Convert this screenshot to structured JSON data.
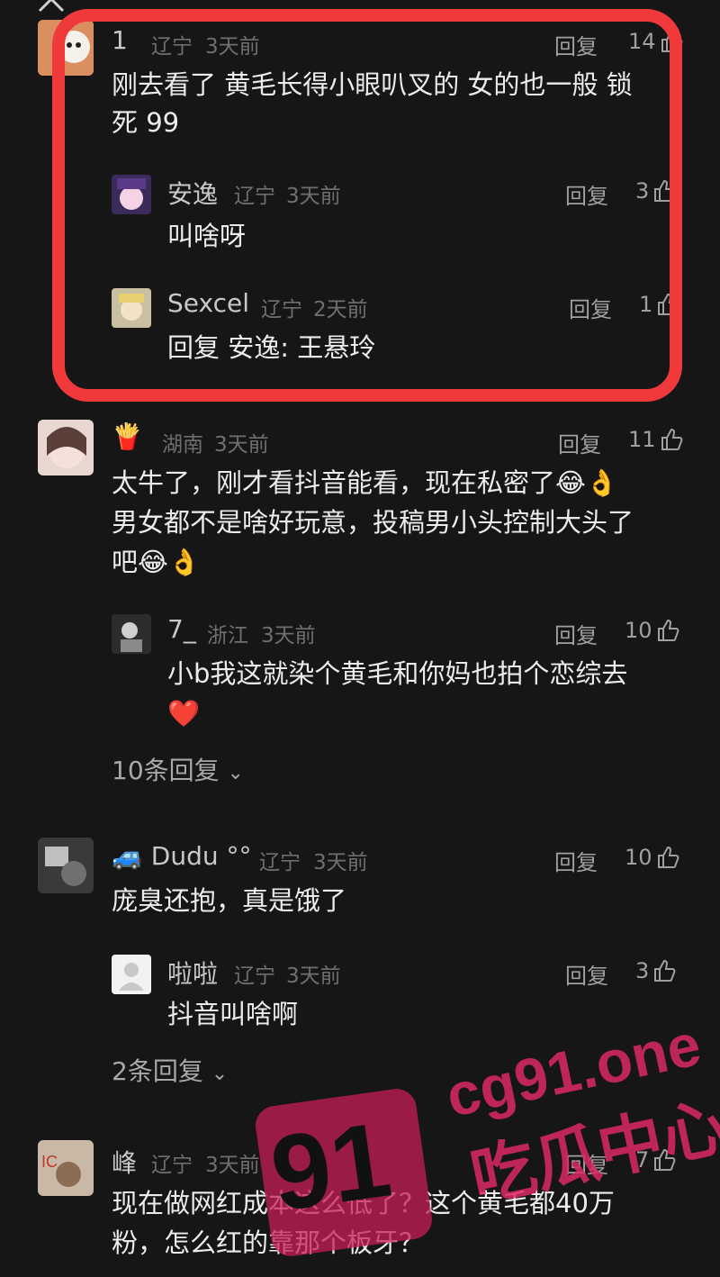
{
  "top": {
    "close_icon": "close-icon"
  },
  "comments": [
    {
      "user": "1",
      "location": "辽宁",
      "time": "3天前",
      "reply_label": "回复",
      "likes": "14",
      "text_lines": [
        "刚去看了 黄毛长得小眼叭叉的 女的也一般 锁",
        "死 99"
      ],
      "replies": [
        {
          "user": "安逸",
          "location": "辽宁",
          "time": "3天前",
          "reply_label": "回复",
          "likes": "3",
          "text": "叫啥呀"
        },
        {
          "user": "Sexcel",
          "location": "辽宁",
          "time": "2天前",
          "reply_label": "回复",
          "likes": "1",
          "text": "回复 安逸: 王悬玲"
        }
      ]
    },
    {
      "user_emoji": "🍟",
      "location": "湖南",
      "time": "3天前",
      "reply_label": "回复",
      "likes": "11",
      "text_lines": [
        "太牛了，刚才看抖音能看，现在私密了😂👌",
        "男女都不是啥好玩意，投稿男小头控制大头了",
        "吧😂👌"
      ],
      "replies": [
        {
          "user": "7_",
          "location": "浙江",
          "time": "3天前",
          "reply_label": "回复",
          "likes": "10",
          "text_lines": [
            "小b我这就染个黄毛和你妈也拍个恋综去",
            "❤️"
          ]
        }
      ],
      "more_replies": "10条回复"
    },
    {
      "user": "🚙 Dudu °°",
      "location": "辽宁",
      "time": "3天前",
      "reply_label": "回复",
      "likes": "10",
      "text_lines": [
        "庞臭还抱，真是饿了"
      ],
      "replies": [
        {
          "user": "啦啦",
          "location": "辽宁",
          "time": "3天前",
          "reply_label": "回复",
          "likes": "3",
          "text": "抖音叫啥啊"
        }
      ],
      "more_replies": "2条回复"
    },
    {
      "user": "峰",
      "location": "辽宁",
      "time": "3天前",
      "reply_label": "回复",
      "likes": "7",
      "text_lines": [
        "现在做网红成本这么低了？这个黄毛都40万",
        "粉，怎么红的靠那个板牙？"
      ]
    }
  ],
  "watermark": {
    "badge": "91",
    "url": "cg91.one",
    "title": "吃瓜中心"
  },
  "colors": {
    "background": "#161616",
    "highlight": "#f0393b",
    "watermark": "#dc2864"
  }
}
